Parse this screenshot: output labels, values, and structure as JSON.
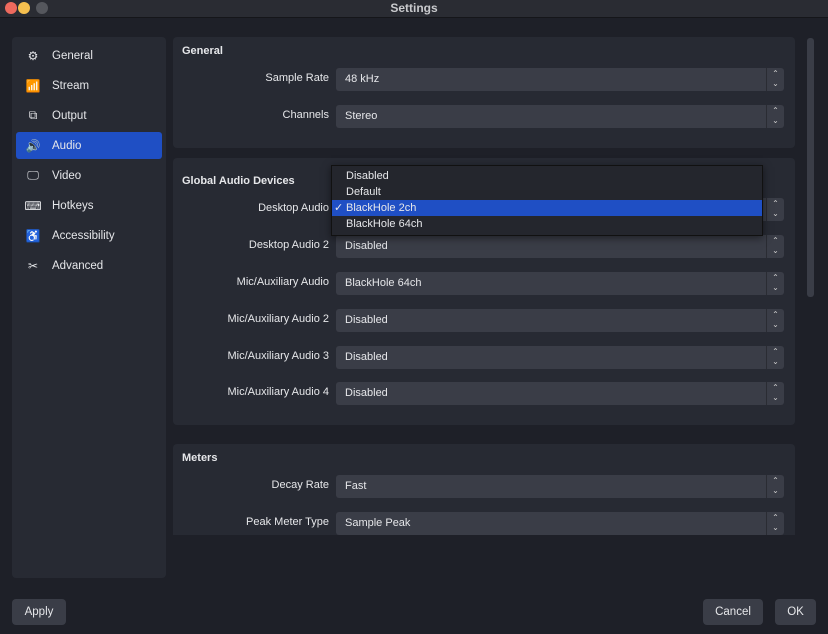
{
  "window": {
    "title": "Settings"
  },
  "sidebar": {
    "items": [
      {
        "label": "General",
        "icon": "gear-icon",
        "glyph": "⚙"
      },
      {
        "label": "Stream",
        "icon": "antenna-icon",
        "glyph": "📶"
      },
      {
        "label": "Output",
        "icon": "output-icon",
        "glyph": "⧉"
      },
      {
        "label": "Audio",
        "icon": "speaker-icon",
        "glyph": "🔊",
        "selected": true
      },
      {
        "label": "Video",
        "icon": "monitor-icon",
        "glyph": "🖵"
      },
      {
        "label": "Hotkeys",
        "icon": "keyboard-icon",
        "glyph": "⌨"
      },
      {
        "label": "Accessibility",
        "icon": "accessibility-icon",
        "glyph": "♿"
      },
      {
        "label": "Advanced",
        "icon": "tools-icon",
        "glyph": "✂"
      }
    ]
  },
  "general": {
    "title": "General",
    "rows": [
      {
        "label": "Sample Rate",
        "value": "48 kHz"
      },
      {
        "label": "Channels",
        "value": "Stereo"
      }
    ]
  },
  "devices": {
    "title": "Global Audio Devices",
    "rows": [
      {
        "label": "Desktop Audio",
        "value": "BlackHole 2ch"
      },
      {
        "label": "Desktop Audio 2",
        "value": "Disabled"
      },
      {
        "label": "Mic/Auxiliary Audio",
        "value": "BlackHole 64ch"
      },
      {
        "label": "Mic/Auxiliary Audio 2",
        "value": "Disabled"
      },
      {
        "label": "Mic/Auxiliary Audio 3",
        "value": "Disabled"
      },
      {
        "label": "Mic/Auxiliary Audio 4",
        "value": "Disabled"
      }
    ]
  },
  "dropdown": {
    "options": [
      "Disabled",
      "Default",
      "BlackHole 2ch",
      "BlackHole 64ch"
    ],
    "selected": "BlackHole 2ch",
    "check": "✓"
  },
  "meters": {
    "title": "Meters",
    "rows": [
      {
        "label": "Decay Rate",
        "value": "Fast"
      },
      {
        "label": "Peak Meter Type",
        "value": "Sample Peak"
      }
    ]
  },
  "buttons": {
    "apply": "Apply",
    "cancel": "Cancel",
    "ok": "OK"
  },
  "colors": {
    "accent": "#1f4fc4",
    "background": "#1e2028",
    "panel": "#272a33"
  }
}
